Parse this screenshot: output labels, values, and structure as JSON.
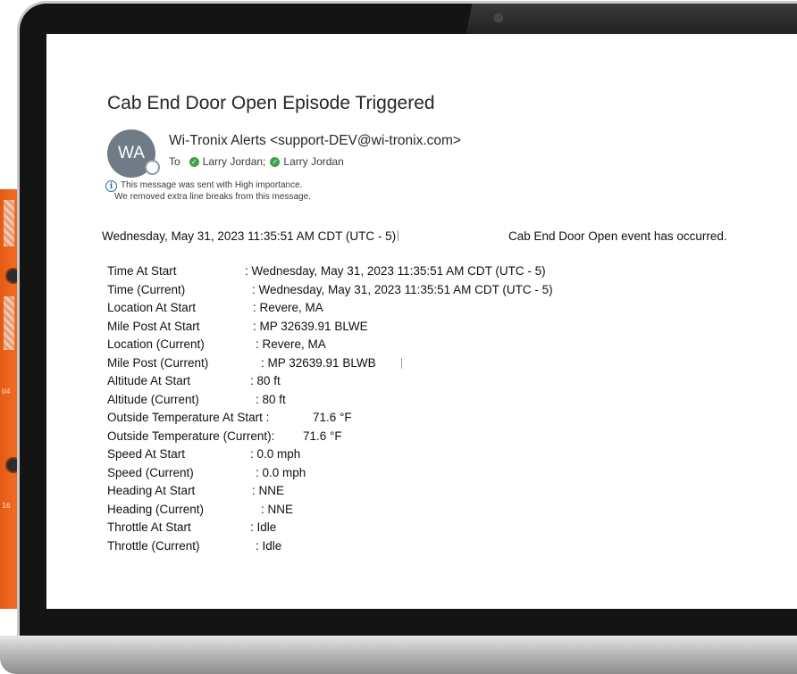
{
  "email": {
    "subject": "Cab End Door Open Episode Triggered",
    "avatar_initials": "WA",
    "sender": "Wi-Tronix Alerts <support-DEV@wi-tronix.com>",
    "to_label": "To",
    "recipients": [
      "Larry Jordan;",
      "Larry Jordan"
    ],
    "info_lines": [
      "This message was sent with High importance.",
      "We removed extra line breaks from this message."
    ],
    "event_timestamp": "Wednesday, May 31, 2023 11:35:51 AM CDT (UTC - 5)",
    "event_message": "Cab End Door Open event has occurred.",
    "details": [
      {
        "label": "Time At Start",
        "value": ": Wednesday, May 31, 2023 11:35:51 AM CDT (UTC - 5)"
      },
      {
        "label": "Time (Current)",
        "value": ": Wednesday, May 31, 2023 11:35:51 AM CDT (UTC - 5)"
      },
      {
        "label": "Location At Start",
        "value": ": Revere, MA"
      },
      {
        "label": "Mile Post At Start",
        "value": ": MP 32639.91 BLWE"
      },
      {
        "label": "Location (Current)",
        "value": ": Revere, MA"
      },
      {
        "label": "Mile Post (Current)",
        "value": ": MP 32639.91 BLWB"
      },
      {
        "label": "Altitude At Start",
        "value": ": 80 ft"
      },
      {
        "label": "Altitude (Current)",
        "value": ": 80 ft"
      },
      {
        "label": "Outside Temperature At Start :",
        "value": "71.6 °F"
      },
      {
        "label": "Outside Temperature (Current):",
        "value": "71.6 °F"
      },
      {
        "label": "Speed At Start",
        "value": ": 0.0 mph"
      },
      {
        "label": "Speed (Current)",
        "value": ": 0.0 mph"
      },
      {
        "label": "Heading At Start",
        "value": ": NNE"
      },
      {
        "label": "Heading (Current)",
        "value": ": NNE"
      },
      {
        "label": "Throttle At Start",
        "value": ": Idle"
      },
      {
        "label": "Throttle (Current)",
        "value": ": Idle"
      }
    ]
  },
  "device": {
    "labels": [
      "U4",
      "16"
    ]
  },
  "colors": {
    "orange": "#f26a1f",
    "purple": "#8a6cd2",
    "avatar": "#6f7c88",
    "presence_check": "#3fa24a",
    "info_blue": "#2b6cb0"
  },
  "icons": [
    "check-icon",
    "info-icon",
    "presence-icon",
    "camera-icon"
  ]
}
